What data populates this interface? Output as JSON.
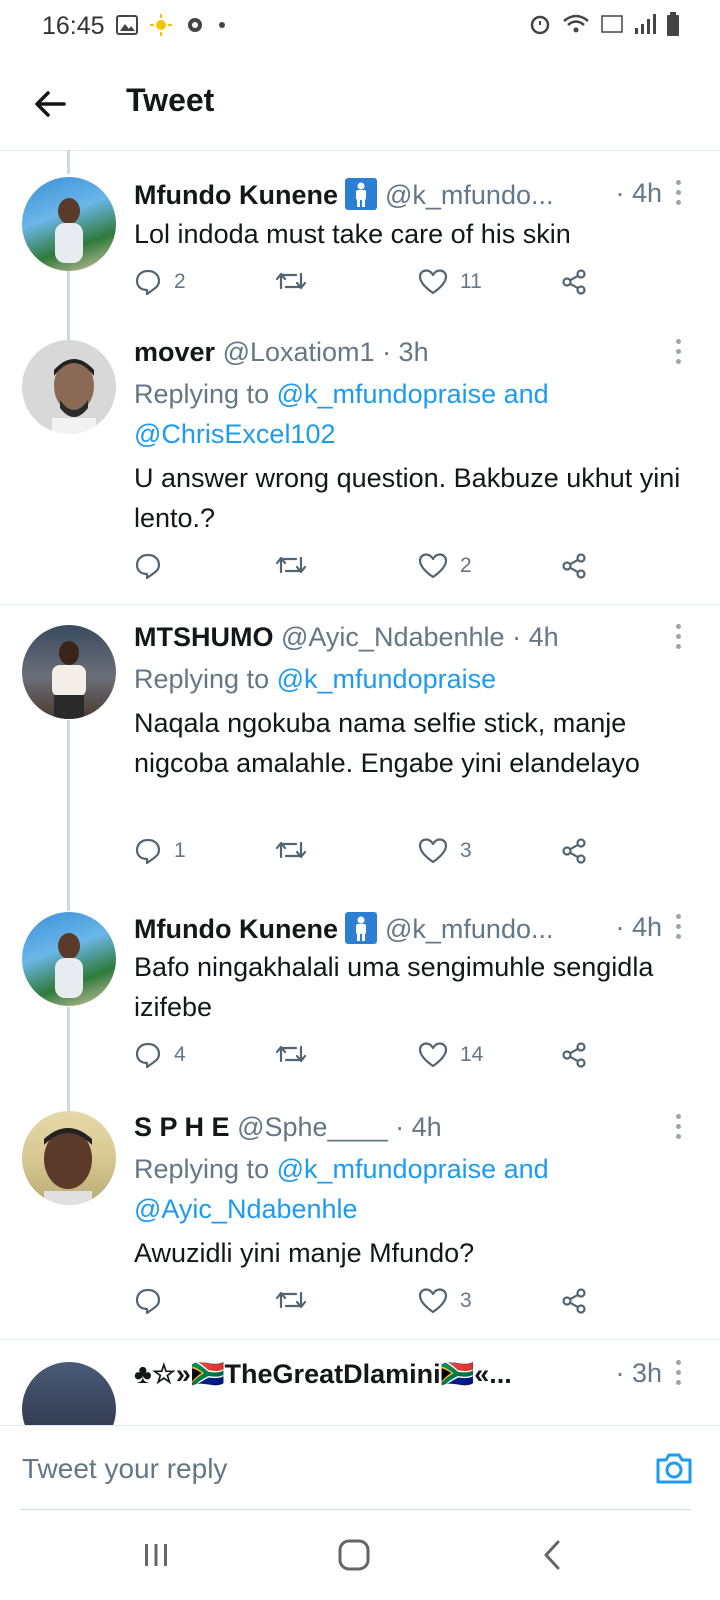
{
  "status_bar": {
    "time": "16:45"
  },
  "header": {
    "title": "Tweet"
  },
  "tweets": [
    {
      "name": "Mfundo Kunene",
      "handle": "@k_mfundo...",
      "time": "· 4h",
      "replying_prefix": "",
      "replying_mentions": "",
      "text": "Lol indoda must take care of his skin",
      "replies": "2",
      "retweets": "",
      "likes": "11"
    },
    {
      "name": "mover",
      "handle": "@Loxatiom1",
      "time": "· 3h",
      "replying_prefix": "Replying to",
      "replying_mentions": "@k_mfundopraise and @ChrisExcel102",
      "text": "U answer wrong question. Bakbuze ukhut yini lento.?",
      "replies": "",
      "retweets": "",
      "likes": "2"
    },
    {
      "name": "MTSHUMO",
      "handle": "@Ayic_Ndabenhle",
      "time": "· 4h",
      "replying_prefix": "Replying to",
      "replying_mentions": "@k_mfundopraise",
      "text": "Naqala ngokuba nama selfie stick, manje nigcoba amalahle. Engabe yini elandelayo",
      "replies": "1",
      "retweets": "",
      "likes": "3"
    },
    {
      "name": "Mfundo Kunene",
      "handle": "@k_mfundo...",
      "time": "· 4h",
      "replying_prefix": "",
      "replying_mentions": "",
      "text": "Bafo ningakhalali uma sengimuhle sengidla izifebe",
      "replies": "4",
      "retweets": "",
      "likes": "14"
    },
    {
      "name": "S P H E",
      "handle": "@Sphe____",
      "time": "· 4h",
      "replying_prefix": "Replying to",
      "replying_mentions": "@k_mfundopraise and @Ayic_Ndabenhle",
      "text": "Awuzidli yini manje Mfundo?",
      "replies": "",
      "retweets": "",
      "likes": "3"
    },
    {
      "name": "♣☆»🇿🇦TheGreatDlamini🇿🇦«...",
      "handle": "",
      "time": "· 3h",
      "replying_prefix": "",
      "replying_mentions": "",
      "text": "",
      "replies": "",
      "retweets": "",
      "likes": ""
    }
  ],
  "compose": {
    "placeholder": "Tweet your reply"
  },
  "colors": {
    "accent": "#1d9bf0",
    "muted": "#657786",
    "text": "#14171a",
    "divider": "#e1e8ed"
  }
}
